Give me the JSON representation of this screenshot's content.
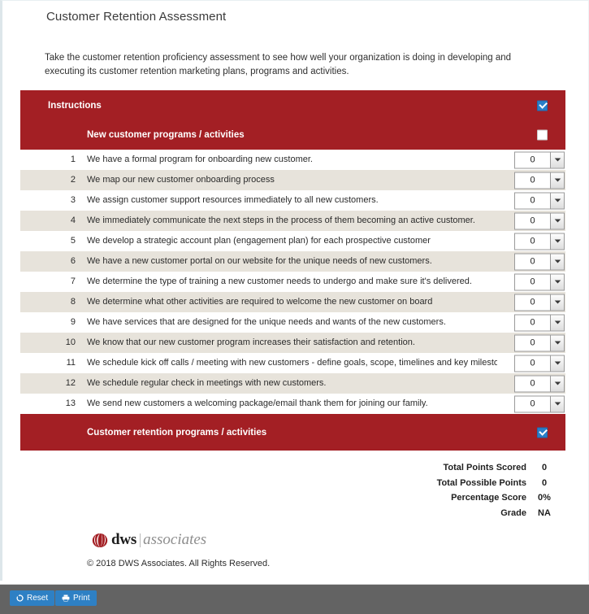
{
  "page": {
    "title": "Customer Retention Assessment",
    "intro": "Take the customer retention proficiency assessment to see how well your organization is doing in developing and executing its customer retention marketing plans, programs and activities."
  },
  "colors": {
    "band_red": "#a31f24",
    "row_alt": "#e7e3db",
    "checkbox_blue": "#2a7fc9",
    "toolbar_bg": "#636363",
    "button_blue": "#2e80c4"
  },
  "bands": {
    "instructions": {
      "label": "Instructions",
      "checkbox": "checked"
    },
    "section_new_customer": {
      "label": "New customer programs / activities",
      "checkbox": "unchecked"
    },
    "section_retention": {
      "label": "Customer retention programs / activities",
      "checkbox": "checked"
    }
  },
  "questions": [
    {
      "num": "1",
      "text": "We have a formal program for onboarding new customer.",
      "value": "0"
    },
    {
      "num": "2",
      "text": "We map our new customer onboarding process",
      "value": "0"
    },
    {
      "num": "3",
      "text": "We assign customer support resources immediately to all new customers.",
      "value": "0"
    },
    {
      "num": "4",
      "text": "We immediately communicate the next steps in the process of them becoming an active customer.",
      "value": "0"
    },
    {
      "num": "5",
      "text": "We develop a strategic account plan (engagement plan) for each prospective customer",
      "value": "0"
    },
    {
      "num": "6",
      "text": "We have a new customer portal on our website for the unique needs of new customers.",
      "value": "0"
    },
    {
      "num": "7",
      "text": "We determine the type of training a new customer needs to undergo and make sure it's delivered.",
      "value": "0"
    },
    {
      "num": "8",
      "text": "We determine what other activities are required to welcome the new customer on board",
      "value": "0"
    },
    {
      "num": "9",
      "text": "We have services that are designed for the unique needs and wants of the new customers.",
      "value": "0"
    },
    {
      "num": "10",
      "text": "We know that our new customer program increases their satisfaction and retention.",
      "value": "0"
    },
    {
      "num": "11",
      "text": "We schedule kick off calls / meeting with new customers - define goals, scope, timelines and key milestones.",
      "value": "0"
    },
    {
      "num": "12",
      "text": "We schedule regular check in meetings with new customers.",
      "value": "0"
    },
    {
      "num": "13",
      "text": "We send new customers a welcoming package/email thank them for joining our family.",
      "value": "0"
    }
  ],
  "scores": [
    {
      "label": "Total Points Scored",
      "value": "0"
    },
    {
      "label": "Total Possible Points",
      "value": "0"
    },
    {
      "label": "Percentage Score",
      "value": "0%"
    },
    {
      "label": "Grade",
      "value": "NA"
    }
  ],
  "footer": {
    "logo_primary": "dws",
    "logo_secondary": "associates",
    "copyright": "© 2018 DWS Associates.  All Rights Reserved."
  },
  "toolbar": {
    "reset_label": "Reset",
    "print_label": "Print"
  }
}
